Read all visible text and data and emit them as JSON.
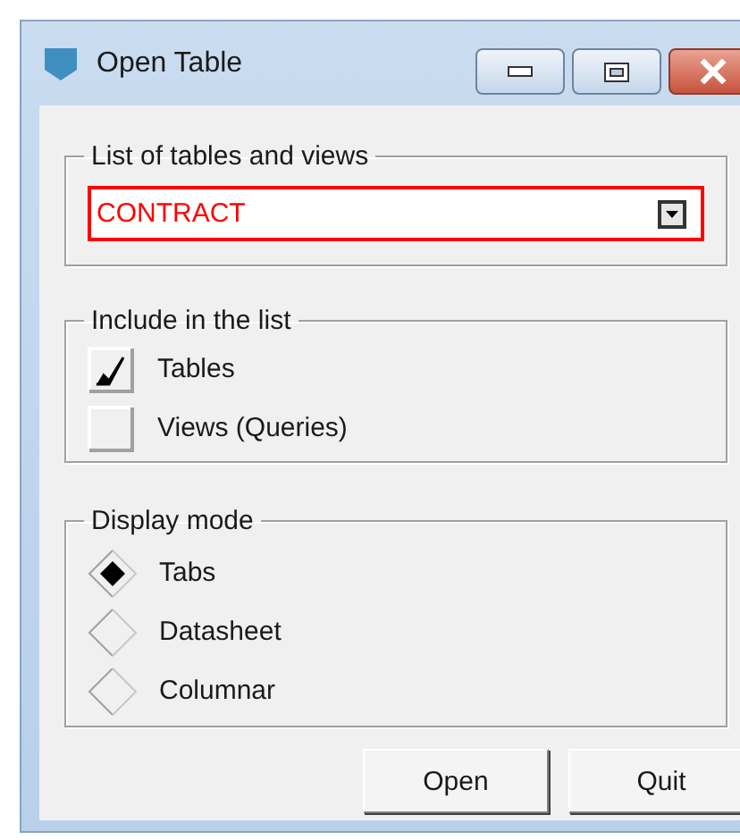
{
  "window": {
    "title": "Open Table"
  },
  "table_group": {
    "title": "List of tables and views",
    "dropdown": {
      "value": "CONTRACT"
    }
  },
  "include_group": {
    "title": "Include in the list",
    "options": [
      {
        "label": "Tables",
        "checked": true
      },
      {
        "label": "Views (Queries)",
        "checked": false
      }
    ]
  },
  "display_group": {
    "title": "Display mode",
    "options": [
      {
        "label": "Tabs",
        "selected": true
      },
      {
        "label": "Datasheet",
        "selected": false
      },
      {
        "label": "Columnar",
        "selected": false
      }
    ]
  },
  "buttons": [
    "Open",
    "Quit"
  ]
}
